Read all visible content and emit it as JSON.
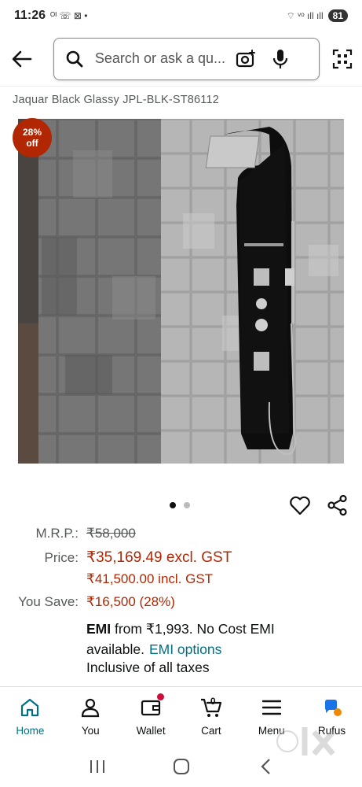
{
  "status": {
    "time": "11:26",
    "left_icons": "ᴼᴵ ☏ ⊠ •",
    "right_icons": "⌔ ᵛᵒ ıll ıll",
    "battery": "81"
  },
  "search": {
    "placeholder": "Search or ask a qu..."
  },
  "product": {
    "title": "Jaquar Black Glassy JPL-BLK-ST86112",
    "badge_percent": "28%",
    "badge_off": "off"
  },
  "carousel": {
    "count": 2,
    "active_index": 0
  },
  "pricing": {
    "mrp_label": "M.R.P.:",
    "mrp_value": "₹58,000",
    "price_label": "Price:",
    "price_excl": "₹35,169.49 excl. GST",
    "price_incl": "₹41,500.00 incl. GST",
    "save_label": "You Save:",
    "save_value": "₹16,500 (28%)",
    "emi_bold": "EMI",
    "emi_text": " from ₹1,993. No Cost EMI available.",
    "emi_link": "EMI options",
    "tax_note": "Inclusive of all taxes"
  },
  "nav": {
    "items": [
      {
        "label": "Home",
        "icon": "home-icon"
      },
      {
        "label": "You",
        "icon": "user-icon"
      },
      {
        "label": "Wallet",
        "icon": "wallet-icon"
      },
      {
        "label": "Cart",
        "icon": "cart-icon",
        "count": "0"
      },
      {
        "label": "Menu",
        "icon": "menu-icon"
      },
      {
        "label": "Rufus",
        "icon": "rufus-icon"
      }
    ]
  },
  "watermark": "olx",
  "colors": {
    "price_red": "#b12704",
    "link_teal": "#007185",
    "active_nav": "#007185"
  }
}
